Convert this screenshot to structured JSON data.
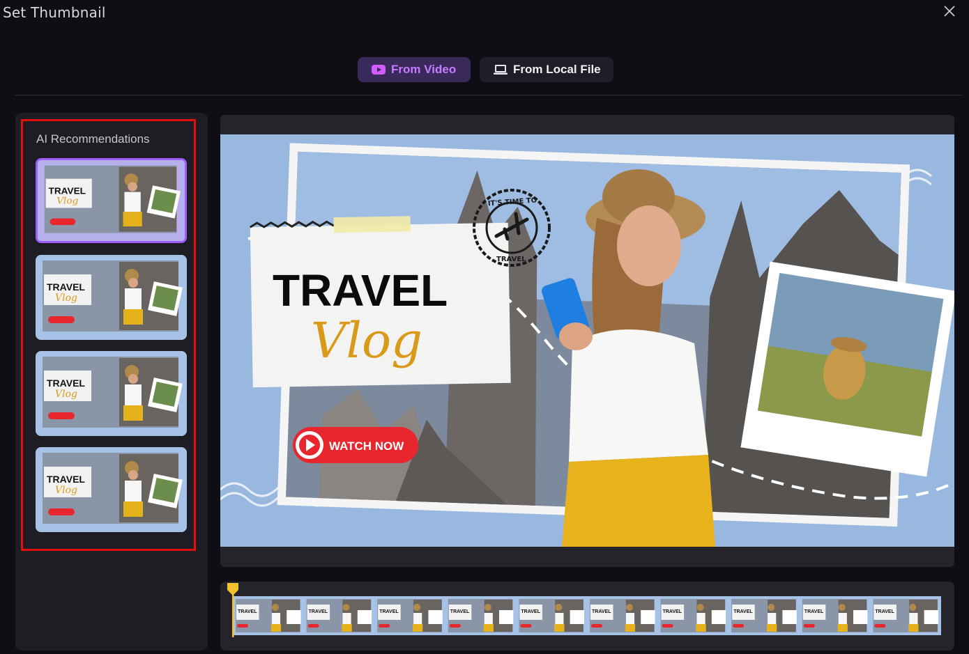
{
  "dialog": {
    "title": "Set Thumbnail",
    "close_icon": "close-icon"
  },
  "tabs": [
    {
      "label": "From Video",
      "icon": "video-play-icon",
      "active": true
    },
    {
      "label": "From Local File",
      "icon": "laptop-icon",
      "active": false
    }
  ],
  "colors": {
    "accent": "#c77dff",
    "active_tab_bg": "#3a2a5c",
    "highlight_box": "#e01010",
    "selected_border": "#a05dff",
    "timeline_marker": "#f2c12e",
    "button_red": "#e8262d"
  },
  "sidebar": {
    "title": "AI Recommendations",
    "thumbnails": [
      {
        "selected": true
      },
      {
        "selected": false
      },
      {
        "selected": false
      },
      {
        "selected": false
      }
    ]
  },
  "preview": {
    "headline": "TRAVEL",
    "script_text": "Vlog",
    "button_label": "WATCH NOW",
    "stamp_top": "IT'S TIME TO",
    "stamp_bottom": "TRAVEL"
  },
  "timeline": {
    "frame_count": 10,
    "playhead_position": 0
  }
}
